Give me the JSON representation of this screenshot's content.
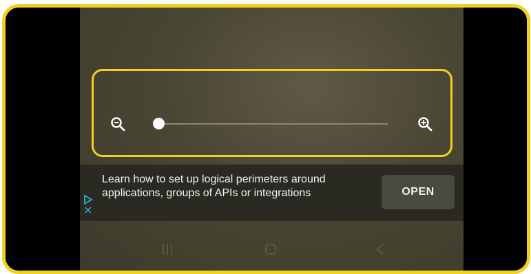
{
  "zoom_control": {
    "zoom_out_icon": "zoom-out-magnifier",
    "zoom_in_icon": "zoom-in-magnifier",
    "slider_level": 0
  },
  "ad": {
    "text": "Learn how to set up logical perimeters around applications, groups of APIs or integrations",
    "button_label": "OPEN",
    "ad_choices_icon": "ad-choices-play-icon",
    "close_icon": "close-icon"
  },
  "nav_bar": {
    "recents_icon": "recents-icon",
    "home_icon": "home-icon",
    "back_icon": "back-icon"
  },
  "colors": {
    "highlight": "#f2d01f",
    "background": "#4a4634",
    "ad_background": "#2b2a22",
    "button_background": "#4a4a40",
    "ad_icon": "#2aa6c8"
  }
}
